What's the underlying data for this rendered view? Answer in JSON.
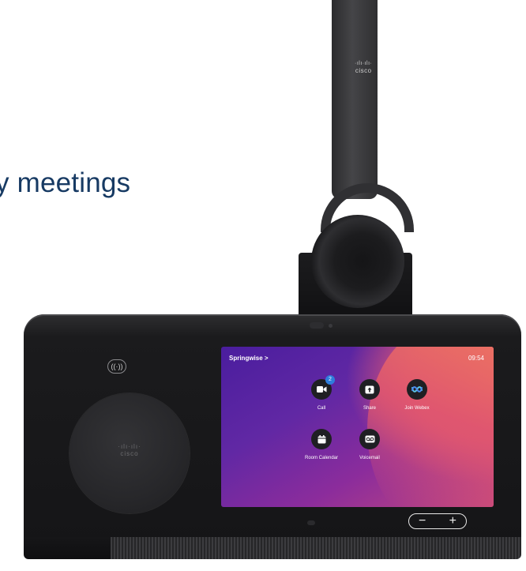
{
  "headline": "y meetings",
  "headset": {
    "logo_text": "cisco"
  },
  "device": {
    "pad_logo_text": "cisco",
    "nfc_symbol": "((·))",
    "volume": {
      "minus": "−",
      "plus": "+"
    }
  },
  "screen": {
    "brand_label": "Springwise >",
    "clock": "09:54",
    "tiles": [
      {
        "label": "Call",
        "icon": "camera-icon",
        "badge": "2"
      },
      {
        "label": "Share",
        "icon": "share-icon"
      },
      {
        "label": "Join Webex",
        "icon": "webex-icon"
      },
      {
        "label": "Room Calendar",
        "icon": "calendar-icon"
      },
      {
        "label": "Voicemail",
        "icon": "voicemail-icon"
      }
    ]
  },
  "colors": {
    "headline": "#173a63",
    "badge": "#2f7ddc",
    "screen_gradient_start": "#4a1d9e",
    "screen_gradient_end": "#ef6a63"
  }
}
